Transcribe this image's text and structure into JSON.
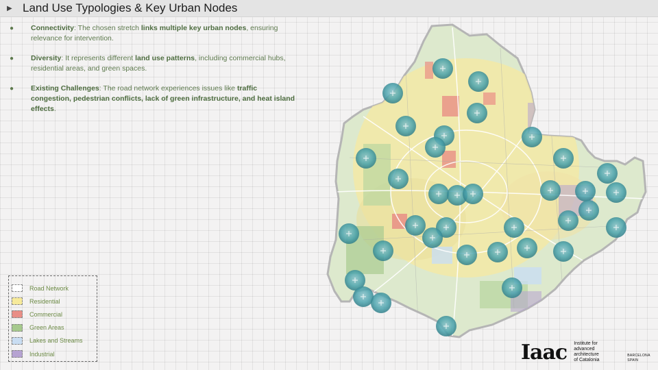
{
  "header": {
    "title": "Land Use Typologies & Key Urban Nodes",
    "arrow_glyph": "▶"
  },
  "bullets": [
    {
      "glyph": "●",
      "segments": [
        {
          "text": "Connectivity",
          "bold": true
        },
        {
          "text": ": The chosen stretch ",
          "bold": false
        },
        {
          "text": "links multiple key urban nodes",
          "bold": true
        },
        {
          "text": ", ensuring relevance for intervention.",
          "bold": false
        }
      ]
    },
    {
      "glyph": "●",
      "segments": [
        {
          "text": "Diversity",
          "bold": true
        },
        {
          "text": ": It represents different ",
          "bold": false
        },
        {
          "text": "land use patterns",
          "bold": true
        },
        {
          "text": ", including commercial hubs, residential areas, and green spaces.",
          "bold": false
        }
      ]
    },
    {
      "glyph": "●",
      "segments": [
        {
          "text": "Existing Challenges",
          "bold": true
        },
        {
          "text": ": The road network experiences issues like ",
          "bold": false
        },
        {
          "text": "traffic congestion, pedestrian conflicts, lack of green infrastructure, and heat island effects",
          "bold": true
        },
        {
          "text": ".",
          "bold": false
        }
      ]
    }
  ],
  "legend": {
    "items": [
      {
        "label": "Road Network",
        "color": "#ffffff"
      },
      {
        "label": "Residential",
        "color": "#f7ea9a"
      },
      {
        "label": "Commercial",
        "color": "#e98e86"
      },
      {
        "label": "Green Areas",
        "color": "#a6c98d"
      },
      {
        "label": "Lakes and Streams",
        "color": "#c9ddf2"
      },
      {
        "label": "Industrial",
        "color": "#b6a3d2"
      }
    ]
  },
  "map": {
    "node_color": "#4aa3ad",
    "base_color": "#dde9cd",
    "urban_color": "#f3e9a6",
    "boundary_color": "#b5b5b5"
  },
  "logo": {
    "mark": "Iaac",
    "institute_lines": [
      "Institute for",
      "advanced",
      "architecture",
      "of Catalonia"
    ],
    "city_lines": [
      "BARCELONA",
      "SPAIN"
    ]
  }
}
